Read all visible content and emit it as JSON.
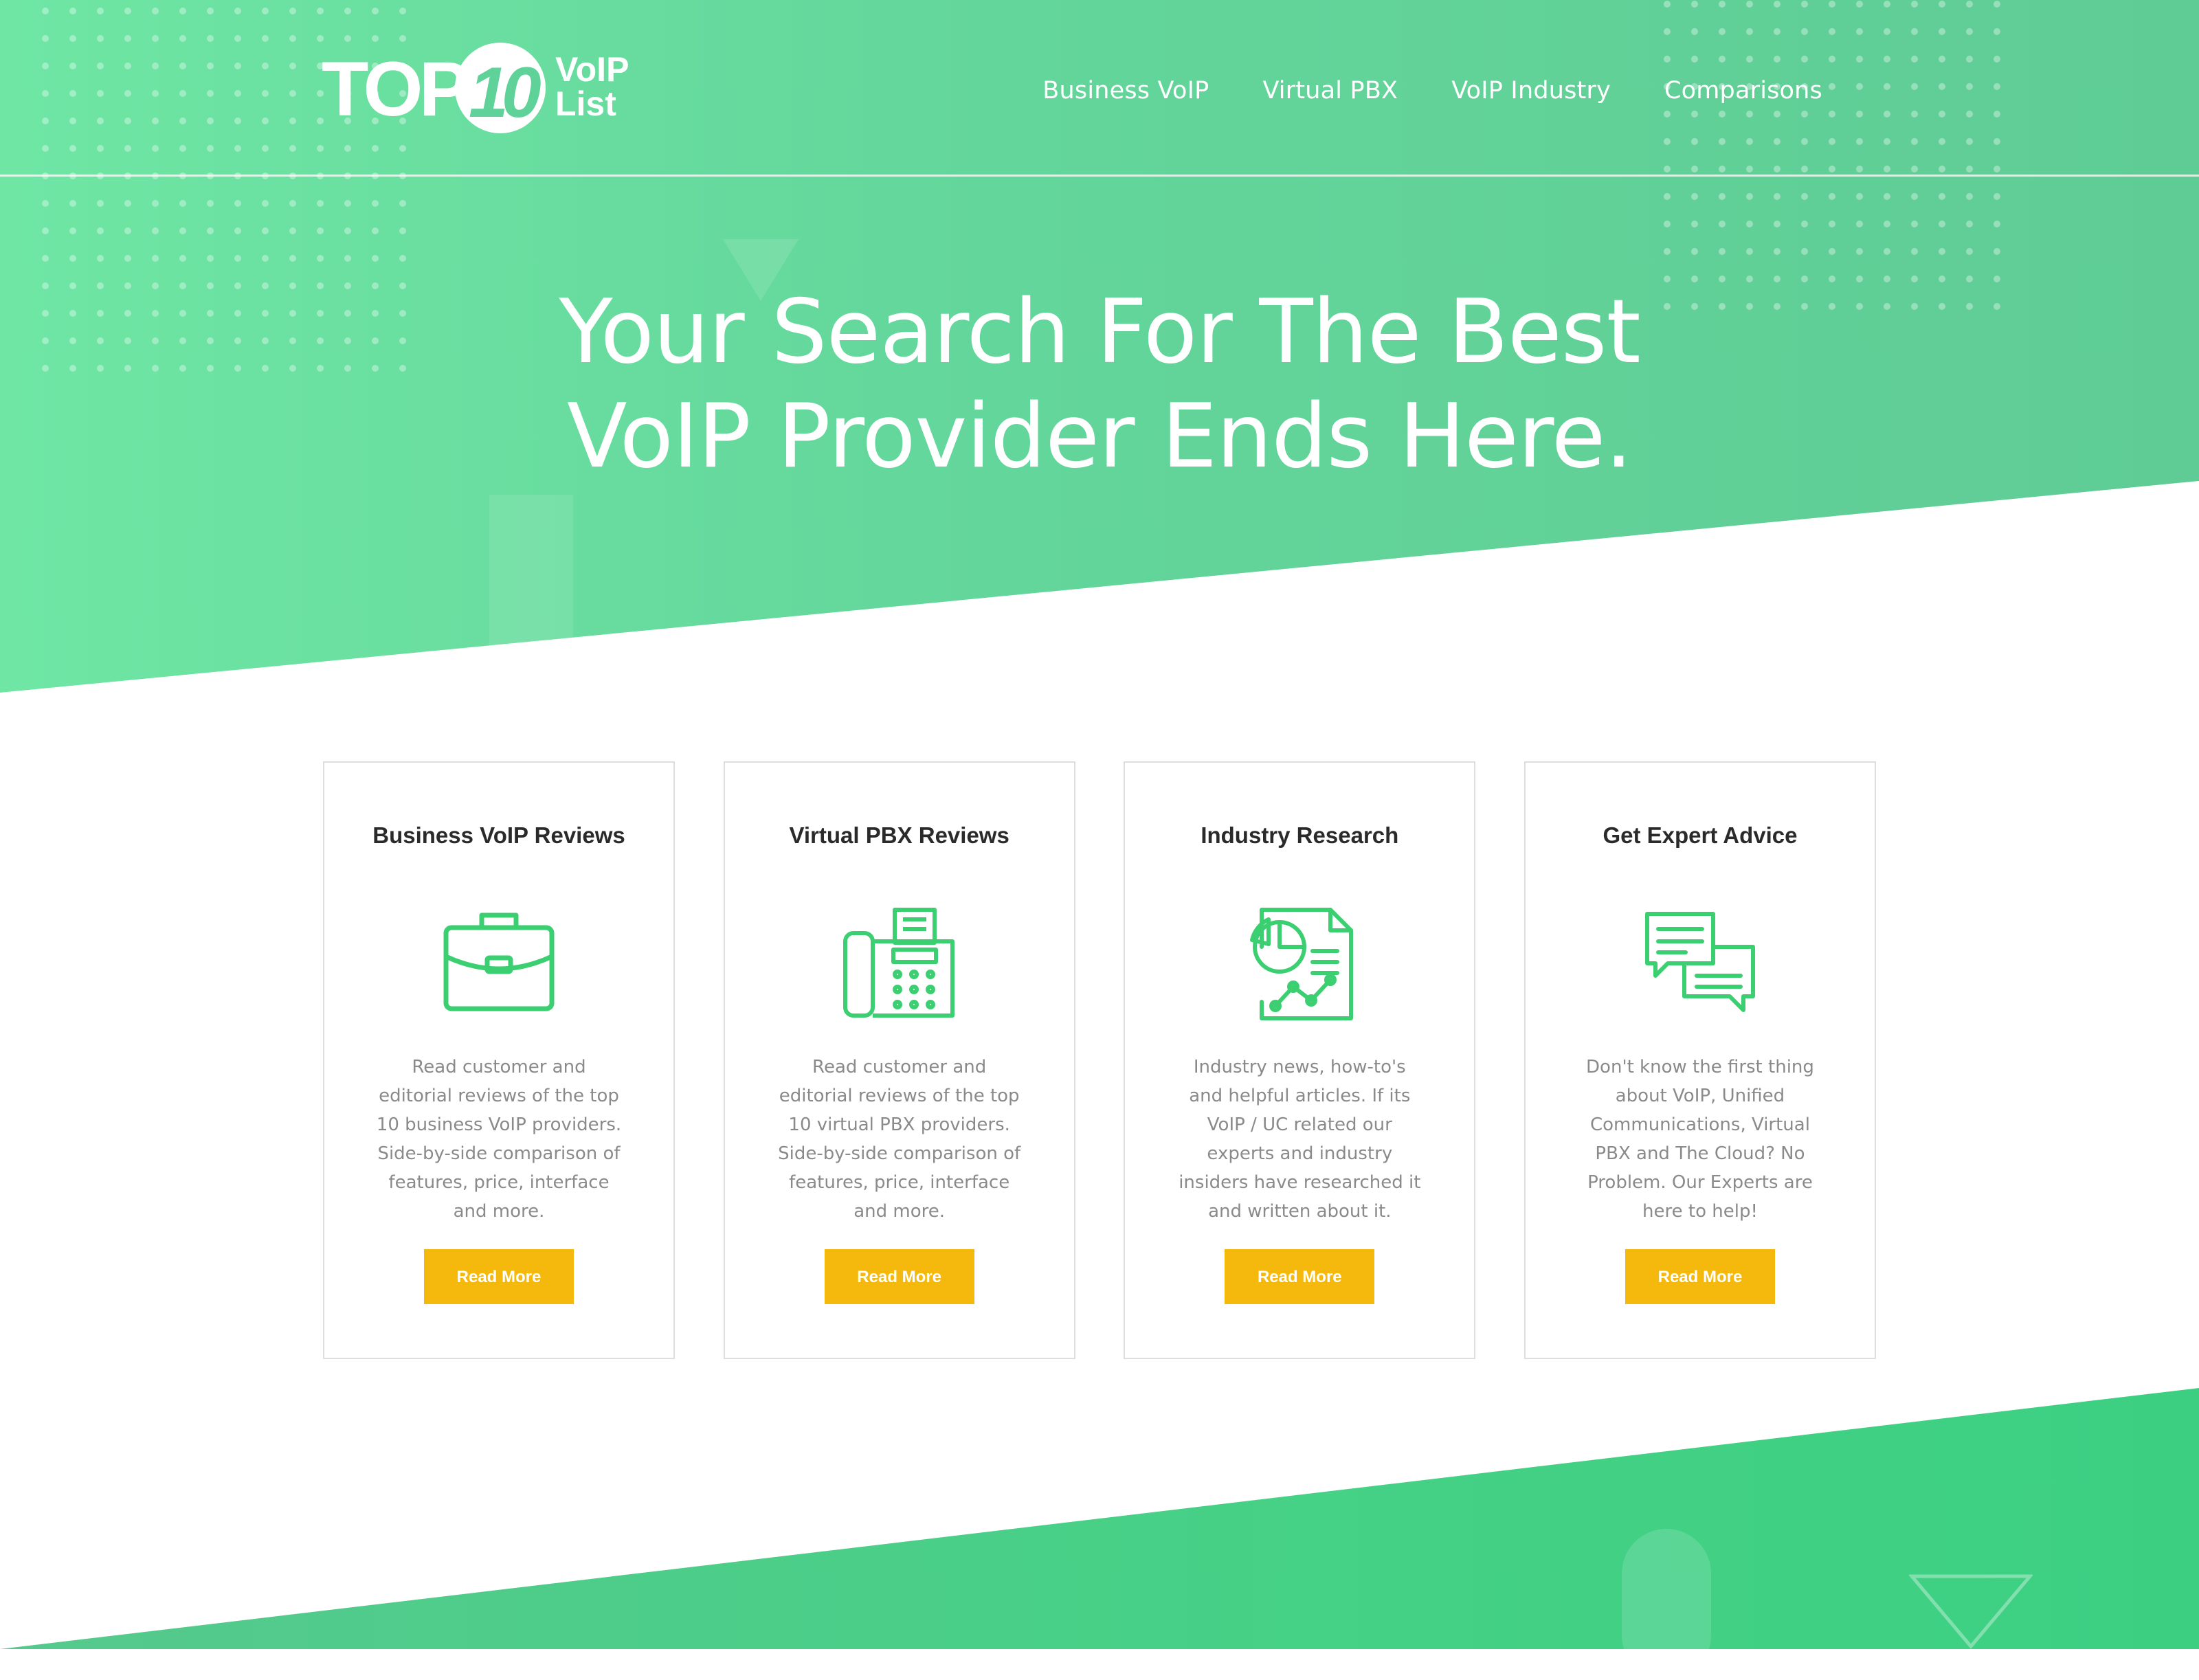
{
  "brand": {
    "logo_top": "TOP",
    "logo_number": "10",
    "logo_line1": "VoIP",
    "logo_line2": "List"
  },
  "nav": {
    "items": [
      {
        "label": "Business VoIP"
      },
      {
        "label": "Virtual PBX"
      },
      {
        "label": "VoIP Industry"
      },
      {
        "label": "Comparisons"
      }
    ]
  },
  "hero": {
    "title_line1": "Your Search For The Best",
    "title_line2": "VoIP Provider Ends Here."
  },
  "cards": [
    {
      "title": "Business VoIP Reviews",
      "icon": "briefcase-icon",
      "text": "Read customer and editorial reviews of the top 10 business VoIP providers. Side-by-side comparison of features, price, interface and more.",
      "button": "Read More"
    },
    {
      "title": "Virtual PBX Reviews",
      "icon": "fax-machine-icon",
      "text": "Read customer and editorial reviews of the top 10 virtual PBX providers. Side-by-side comparison of features, price, interface and more.",
      "button": "Read More"
    },
    {
      "title": "Industry Research",
      "icon": "report-chart-icon",
      "text": "Industry news, how-to's and helpful articles. If its VoIP / UC related our experts and industry insiders have researched it and written about it.",
      "button": "Read More"
    },
    {
      "title": "Get Expert Advice",
      "icon": "chat-bubbles-icon",
      "text": "Don't know the first thing about VoIP, Unified Communications, Virtual PBX and The Cloud? No Problem. Our Experts are here to help!",
      "button": "Read More"
    }
  ],
  "colors": {
    "hero_green": "#63d69b",
    "icon_green": "#3ccf72",
    "button_yellow": "#f5b90e",
    "card_border": "#dedede",
    "body_text": "#8a8a8a"
  }
}
